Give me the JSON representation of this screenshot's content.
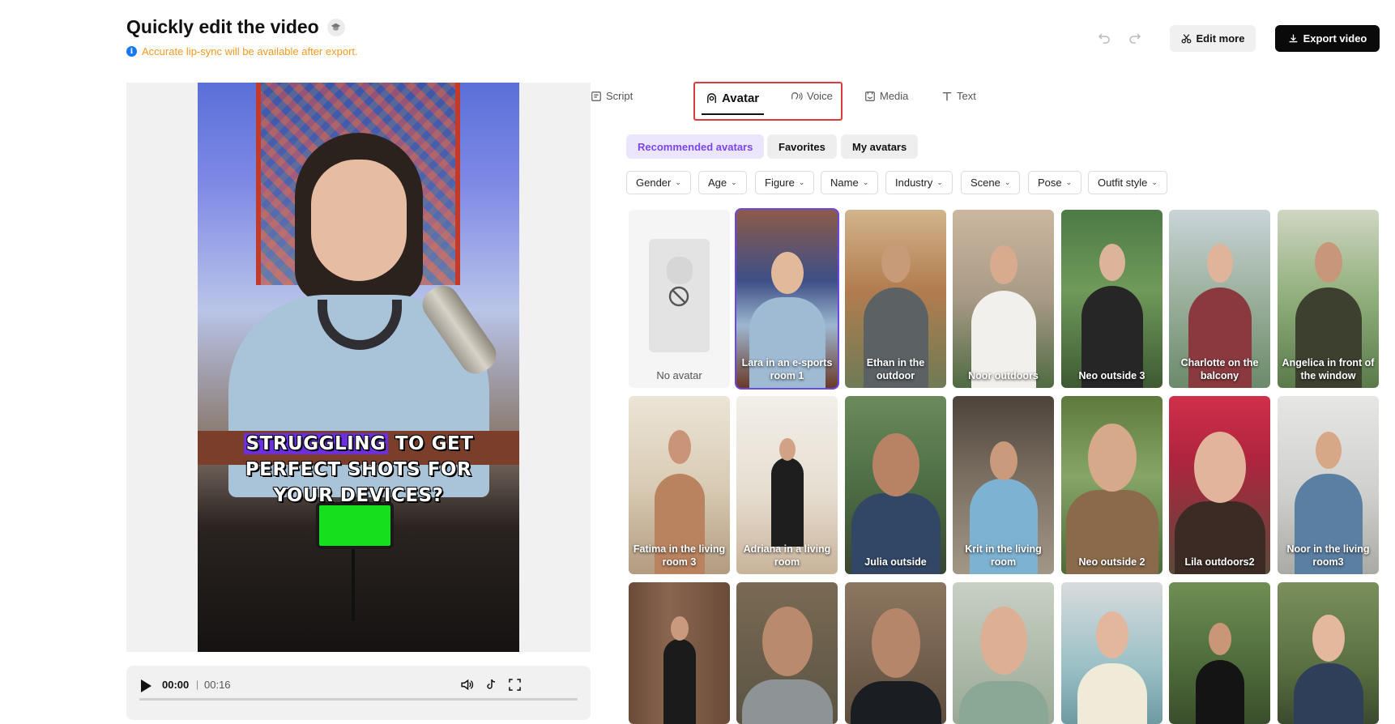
{
  "header": {
    "title": "Quickly edit the video",
    "notice": "Accurate lip-sync will be available after export.",
    "edit_more_label": "Edit more",
    "export_label": "Export video"
  },
  "preview": {
    "caption_highlight": "STRUGGLING",
    "caption_rest_line1": "TO GET",
    "caption_line2": "PERFECT SHOTS FOR",
    "caption_line3": "YOUR DEVICES?",
    "time_current": "00:00",
    "time_total": "00:16",
    "progress": 0
  },
  "tabs": [
    {
      "label": "Script",
      "icon": "script-icon"
    },
    {
      "label": "Avatar",
      "icon": "avatar-icon",
      "active": true
    },
    {
      "label": "Voice",
      "icon": "voice-icon"
    },
    {
      "label": "Media",
      "icon": "media-icon"
    },
    {
      "label": "Text",
      "icon": "text-icon"
    }
  ],
  "categories": [
    "Recommended avatars",
    "Favorites",
    "My avatars"
  ],
  "filters": [
    "Gender",
    "Age",
    "Figure",
    "Name",
    "Industry",
    "Scene",
    "Pose",
    "Outfit style"
  ],
  "avatars": {
    "no_avatar_label": "No avatar",
    "row1": [
      "Lara in an e-sports room 1",
      "Ethan in the outdoor",
      "Noor outdoors",
      "Neo outside 3",
      "Charlotte on the balcony",
      "Angelica in front of the window"
    ],
    "row2": [
      "Fatima in the living room 3",
      "Adriana in a living room",
      "Julia outside",
      "Krit in the living room",
      "Neo outside 2",
      "Lila outdoors2",
      "Noor in the living room3"
    ],
    "selected": "Lara in an e-sports room 1"
  },
  "colors": {
    "accent": "#6d47e4",
    "export_bg": "#0a0a0a",
    "notice": "#f59a23",
    "highlight_box": "#e03a3a"
  }
}
